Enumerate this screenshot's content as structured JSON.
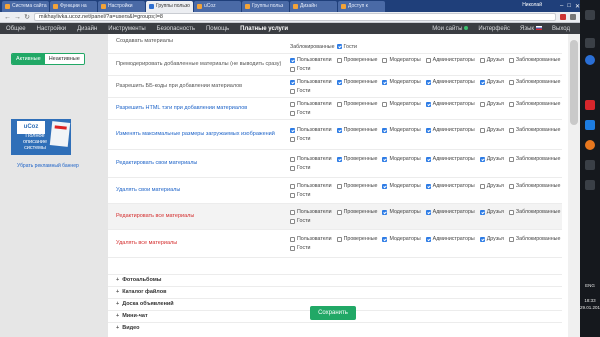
{
  "browser": {
    "tabs": [
      {
        "label": "Система сайта"
      },
      {
        "label": "Функции на"
      },
      {
        "label": "Настройки"
      },
      {
        "label": "Группы пользо"
      },
      {
        "label": "uCoz"
      },
      {
        "label": "Группы польз"
      },
      {
        "label": "Дизайн"
      },
      {
        "label": "Доступ к"
      }
    ],
    "user": "Николай",
    "url": "mikhaylivka.ucoz.net/panel/?a=users&l=groups;l=8"
  },
  "topnav": {
    "items": [
      "Общее",
      "Настройки",
      "Дизайн",
      "Инструменты",
      "Безопасность",
      "Помощь"
    ],
    "paid": "Платные услуги",
    "mysites": "Мои сайты",
    "interface": "Интерфейс",
    "lang": "Язык",
    "logout": "Выход"
  },
  "left": {
    "active_label": "Активные",
    "inactive_label": "Неактивные",
    "banner_brand": "uCoz",
    "banner_text": "Полное описание системы",
    "remove_banner": "Убрать рекламный баннер"
  },
  "permissions": [
    {
      "label": "Удалять все материалы (скрыто)"
    },
    {
      "label": "Премодерировать добавленные материалы (не выводить сразу)",
      "checks": [
        true,
        false,
        false,
        false,
        false,
        false
      ]
    },
    {
      "label": "Разрешить ББ-коды при добавлении материалов",
      "checks": [
        true,
        true,
        true,
        true,
        true,
        false
      ]
    },
    {
      "label": "Разрешить HTML тэги при добавлении материалов",
      "checks": [
        false,
        false,
        false,
        true,
        false,
        false
      ]
    },
    {
      "label": "Изменять максимальные размеры загружаемых изображений",
      "checks": [
        true,
        true,
        true,
        true,
        false,
        false
      ]
    },
    {
      "label": "Редактировать свои материалы",
      "checks": [
        false,
        true,
        true,
        true,
        true,
        false
      ]
    },
    {
      "label": "Удалять свои материалы",
      "checks": [
        false,
        false,
        true,
        true,
        false,
        false
      ]
    },
    {
      "label": "Редактировать все материалы",
      "checks": [
        false,
        false,
        true,
        true,
        true,
        false
      ]
    },
    {
      "label": "Удалять все материалы",
      "checks": [
        false,
        false,
        true,
        true,
        true,
        false
      ]
    }
  ],
  "group_names": [
    "Пользователи",
    "Проверенные",
    "Модераторы",
    "Администраторы",
    "Друзья",
    "Заблокированные",
    "Гости"
  ],
  "top_partial": {
    "label": "Создавать материалы",
    "locked": "Заблокированные",
    "guests": "Гости"
  },
  "sections": [
    "Фотоальбомы",
    "Каталог файлов",
    "Доска объявлений",
    "Мини-чат",
    "Видео"
  ],
  "save_label": "Сохранить",
  "taskbar": {
    "lang": "ENG",
    "time": "18:33",
    "date": "29.01.2017"
  }
}
